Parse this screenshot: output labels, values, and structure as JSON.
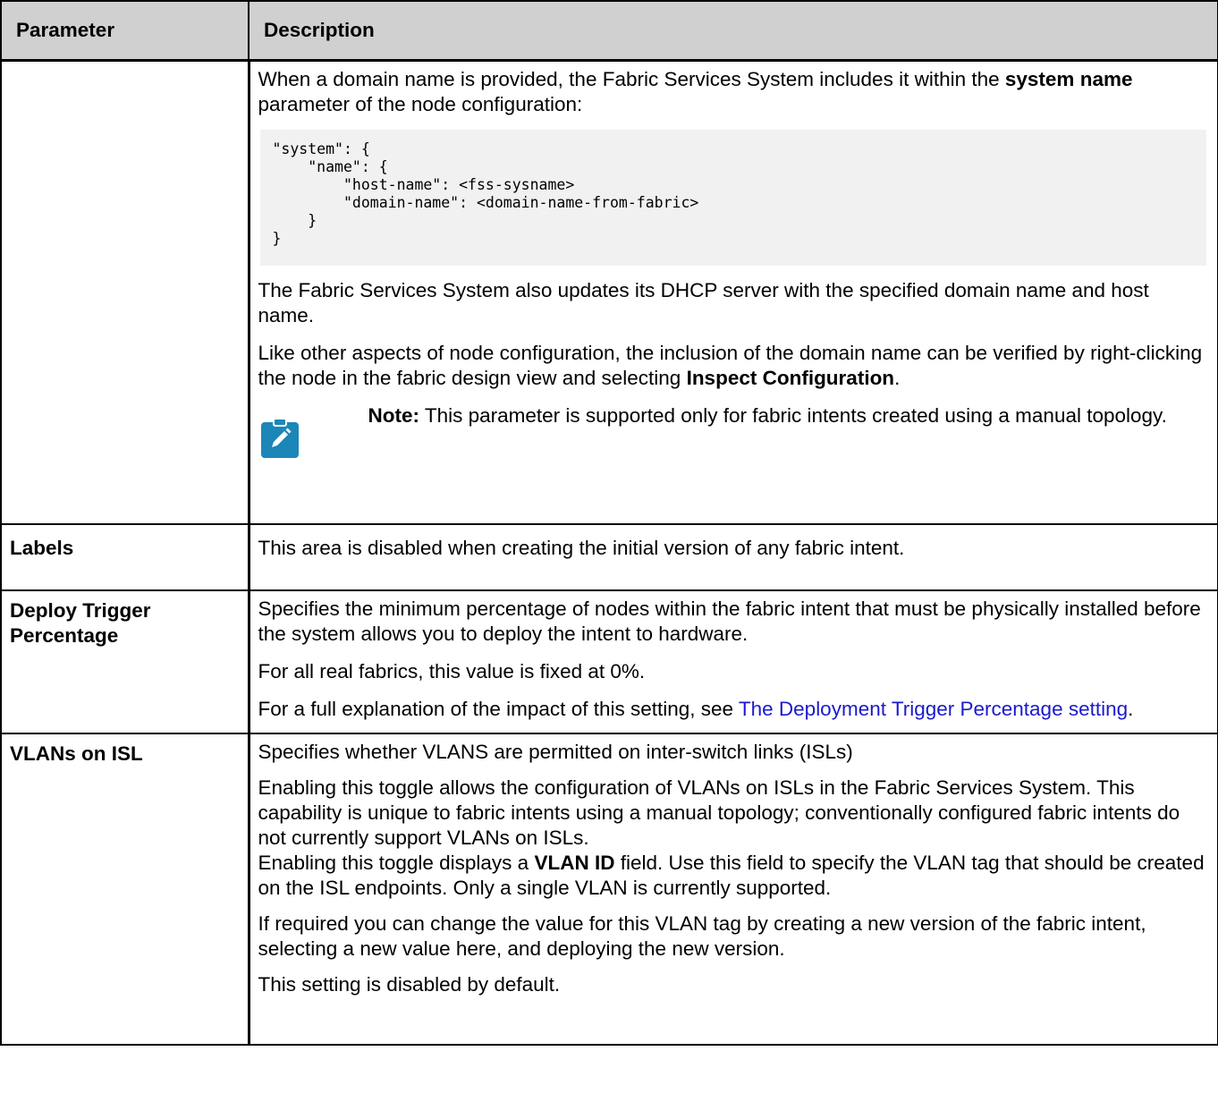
{
  "table": {
    "headers": {
      "parameter": "Parameter",
      "description": "Description"
    },
    "row_domain": {
      "p1_a": "When a domain name is provided, the Fabric Services System includes it within the ",
      "p1_bold": "system name",
      "p1_b": " parameter of the node configuration:",
      "code": "\"system\": {\n    \"name\": {\n        \"host-name\": <fss-sysname>\n        \"domain-name\": <domain-name-from-fabric>\n    }\n}",
      "p2": "The Fabric Services System also updates its DHCP server with the specified domain name and host name.",
      "p3_a": "Like other aspects of node configuration, the inclusion of the domain name can be verified by right-clicking the node in the fabric design view and selecting ",
      "p3_bold": "Inspect Configuration",
      "p3_b": ".",
      "note_label": "Note:",
      "note_text": " This parameter is supported only for fabric intents created using a manual topology.",
      "note_icon": "edit-pencil-icon",
      "note_icon_color": "#1b87b8"
    },
    "row_labels": {
      "parameter": "Labels",
      "description": "This area is disabled when creating the initial version of any fabric intent."
    },
    "row_deploy": {
      "parameter": "Deploy Trigger Percentage",
      "p1": "Specifies the minimum percentage of nodes within the fabric intent that must be physically installed before the system allows you to deploy the intent to hardware.",
      "p2": "For all real fabrics, this value is fixed at 0%.",
      "p3_a": "For a full explanation of the impact of this setting, see ",
      "p3_link": "The Deployment Trigger Percentage setting",
      "p3_b": ".",
      "link_color": "#1a1acd"
    },
    "row_vlans": {
      "parameter": "VLANs on ISL",
      "p1": "Specifies whether VLANS are permitted on inter-switch links (ISLs)",
      "p2": "Enabling this toggle allows the configuration of VLANs on ISLs in the Fabric Services System. This capability is unique to fabric intents using a manual topology; conventionally configured fabric intents do not currently support VLANs on ISLs.",
      "p2b_a": "Enabling this toggle displays a ",
      "p2b_bold": "VLAN ID",
      "p2b_b": " field. Use this field to specify the VLAN tag that should be created on the ISL endpoints. Only a single VLAN is currently supported.",
      "p3": "If required you can change the value for this VLAN tag by creating a new version of the fabric intent, selecting a new value here, and deploying the new version.",
      "p4": "This setting is disabled by default."
    }
  }
}
